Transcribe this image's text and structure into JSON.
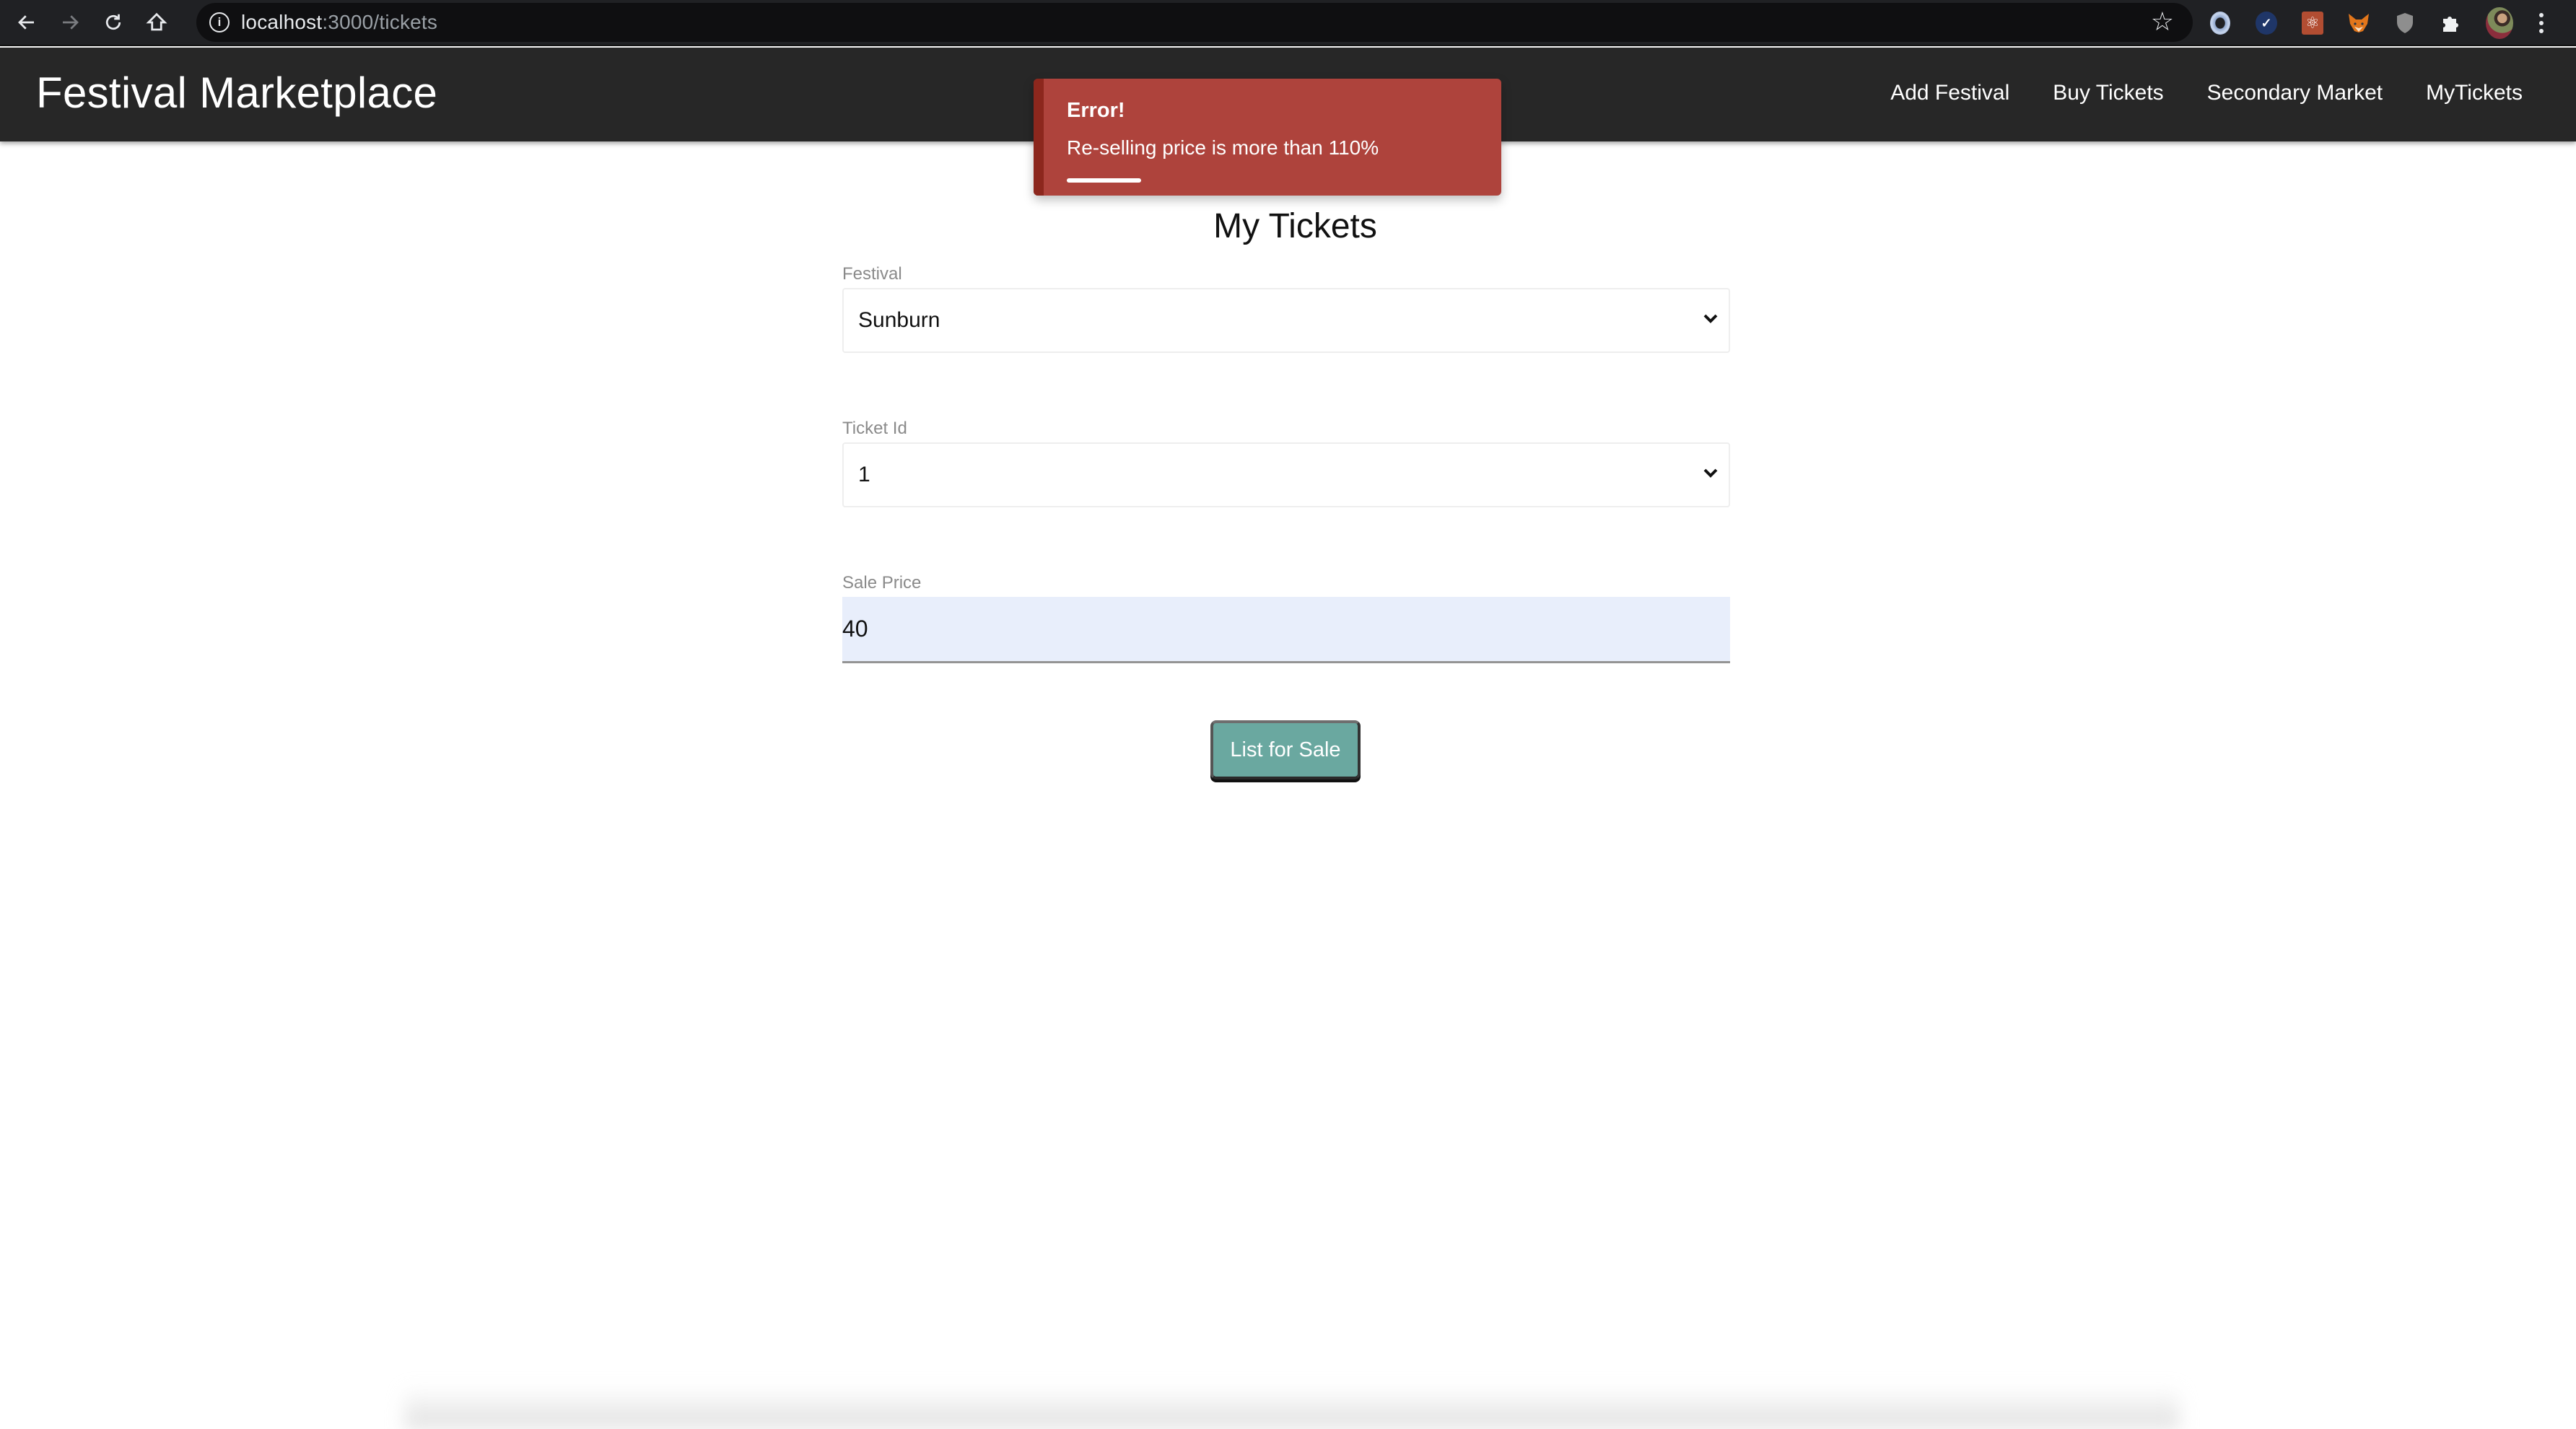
{
  "browser": {
    "url_host": "localhost",
    "url_rest": ":3000/tickets",
    "extensions": [
      "json-viewer-icon",
      "checkmark-extension-icon",
      "react-devtools-icon",
      "metamask-fox-icon",
      "shield-extension-icon",
      "puzzle-extensions-icon"
    ],
    "nav_icons": {
      "back": "back-arrow-icon",
      "forward": "forward-arrow-icon",
      "reload": "reload-icon",
      "home": "home-icon"
    }
  },
  "navbar": {
    "brand": "Festival Marketplace",
    "links": [
      {
        "label": "Add Festival"
      },
      {
        "label": "Buy Tickets"
      },
      {
        "label": "Secondary Market"
      },
      {
        "label": "MyTickets"
      }
    ]
  },
  "toast": {
    "title": "Error!",
    "message": "Re-selling price is more than 110%",
    "progress_fraction": 0.19,
    "color": "#ae433c",
    "stripe_color": "#8c271d"
  },
  "form": {
    "title": "My Tickets",
    "festival": {
      "label": "Festival",
      "value": "Sunburn"
    },
    "ticket_id": {
      "label": "Ticket Id",
      "value": "1"
    },
    "sale_price": {
      "label": "Sale Price",
      "value": "40"
    },
    "submit_label": "List for Sale",
    "submit_color": "#6aa8a0"
  }
}
